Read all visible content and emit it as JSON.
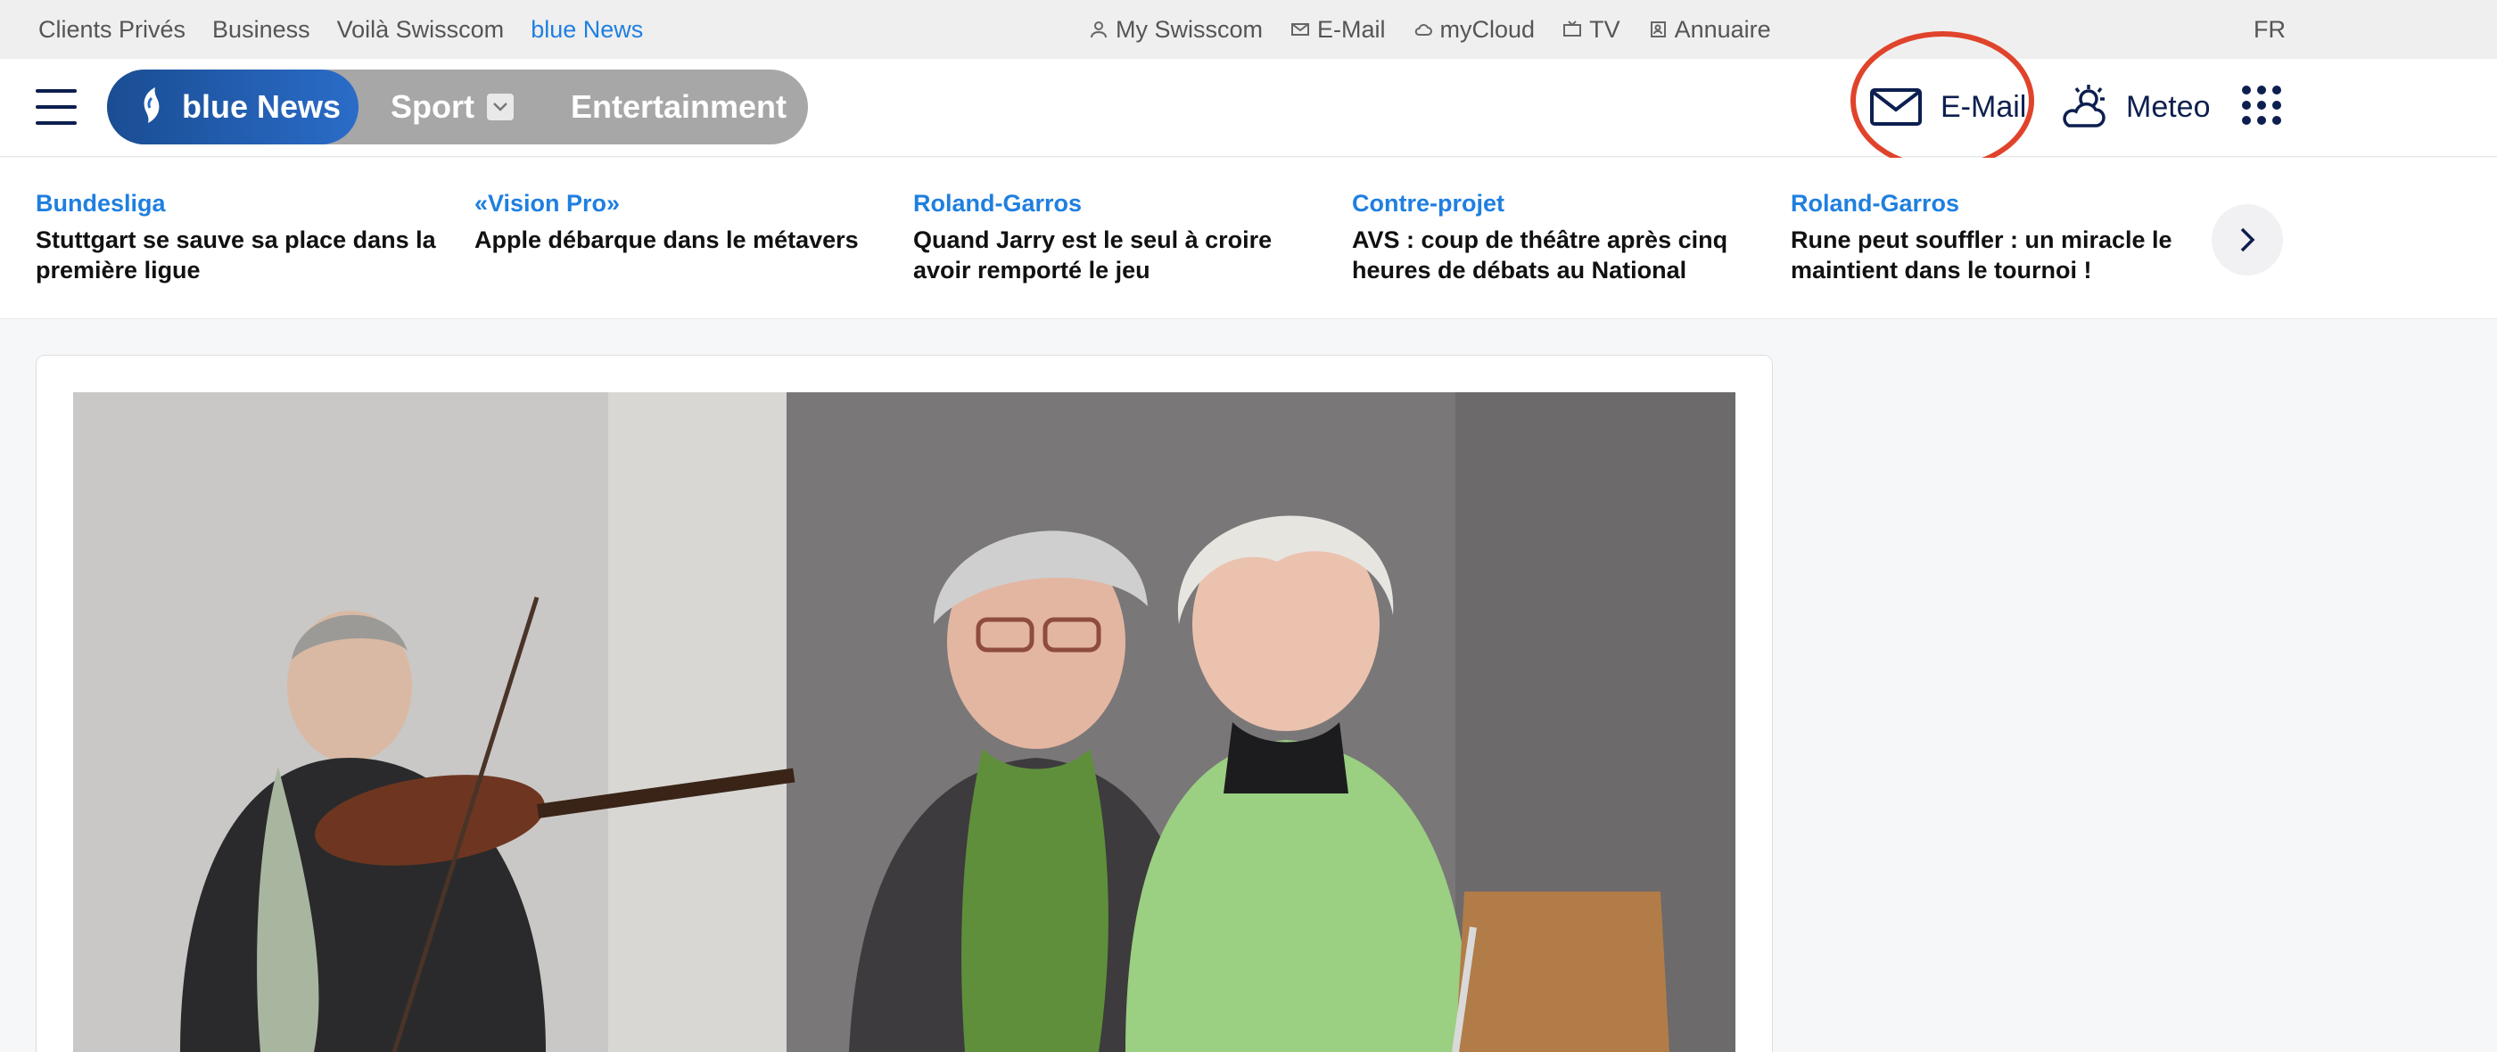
{
  "topbar": {
    "left_links": [
      "Clients Privés",
      "Business",
      "Voilà Swisscom",
      "blue News"
    ],
    "services": [
      {
        "label": "My Swisscom",
        "icon": "user-icon"
      },
      {
        "label": "E-Mail",
        "icon": "envelope-icon"
      },
      {
        "label": "myCloud",
        "icon": "cloud-icon"
      },
      {
        "label": "TV",
        "icon": "tv-icon"
      },
      {
        "label": "Annuaire",
        "icon": "directory-icon"
      }
    ],
    "language": "FR"
  },
  "header": {
    "brand": "blue News",
    "tabs": [
      {
        "label": "Sport",
        "has_dropdown": true
      },
      {
        "label": "Entertainment",
        "has_dropdown": false
      }
    ],
    "email_label": "E-Mail",
    "meteo_label": "Meteo"
  },
  "ticker": {
    "items": [
      {
        "category": "Bundesliga",
        "title": "Stuttgart se sauve sa place dans la première ligue"
      },
      {
        "category": "«Vision Pro»",
        "title": "Apple débarque dans le métavers"
      },
      {
        "category": "Roland-Garros",
        "title": "Quand Jarry est le seul à croire avoir remporté le jeu"
      },
      {
        "category": "Contre-projet",
        "title": "AVS : coup de théâtre après cinq heures de débats au National"
      },
      {
        "category": "Roland-Garros",
        "title": "Rune peut souffler : un miracle le maintient dans le tournoi !"
      }
    ]
  },
  "colors": {
    "accent_blue": "#1f7fe0",
    "navy": "#0d1f4f",
    "annotation_red": "#e0432b"
  }
}
